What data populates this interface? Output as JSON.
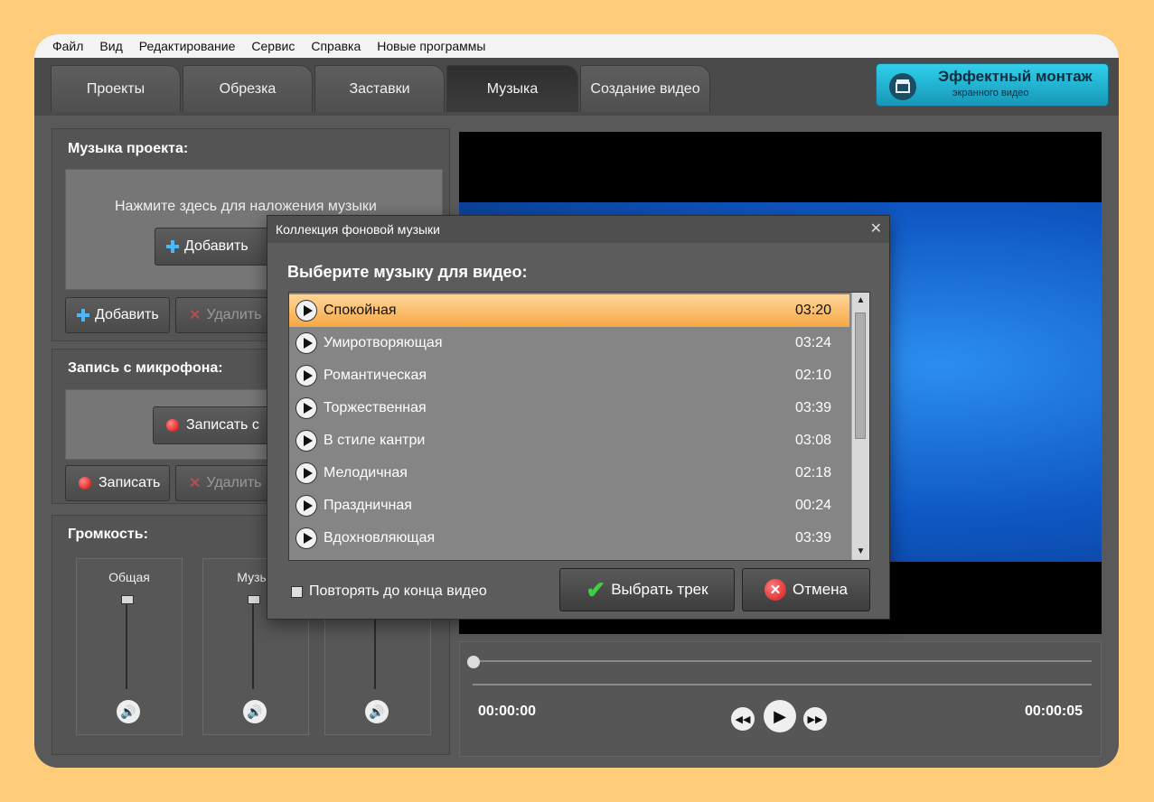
{
  "menu": [
    "Файл",
    "Вид",
    "Редактирование",
    "Сервис",
    "Справка",
    "Новые программы"
  ],
  "tabs": [
    "Проекты",
    "Обрезка",
    "Заставки",
    "Музыка",
    "Создание видео"
  ],
  "promo": {
    "title": "Эффектный монтаж",
    "subtitle": "экранного видео"
  },
  "music_panel": {
    "title": "Музыка проекта:",
    "hint": "Нажмите здесь для наложения музыки",
    "add_inner": "Добавить",
    "add": "Добавить",
    "delete": "Удалить"
  },
  "mic_panel": {
    "title": "Запись с микрофона:",
    "record_inner": "Записать с",
    "record": "Записать",
    "delete": "Удалить"
  },
  "volume_panel": {
    "title": "Громкость:",
    "col1": "Общая",
    "col2": "Музык"
  },
  "player": {
    "time_start": "00:00:00",
    "time_end": "00:00:05"
  },
  "dialog": {
    "title": "Коллекция фоновой музыки",
    "heading": "Выберите музыку для видео:",
    "tracks": [
      {
        "name": "Спокойная",
        "duration": "03:20"
      },
      {
        "name": "Умиротворяющая",
        "duration": "03:24"
      },
      {
        "name": "Романтическая",
        "duration": "02:10"
      },
      {
        "name": "Торжественная",
        "duration": "03:39"
      },
      {
        "name": "В стиле кантри",
        "duration": "03:08"
      },
      {
        "name": "Мелодичная",
        "duration": "02:18"
      },
      {
        "name": "Праздничная",
        "duration": "00:24"
      },
      {
        "name": "Вдохновляющая",
        "duration": "03:39"
      }
    ],
    "repeat_label": "Повторять до конца видео",
    "select_button": "Выбрать трек",
    "cancel_button": "Отмена"
  }
}
